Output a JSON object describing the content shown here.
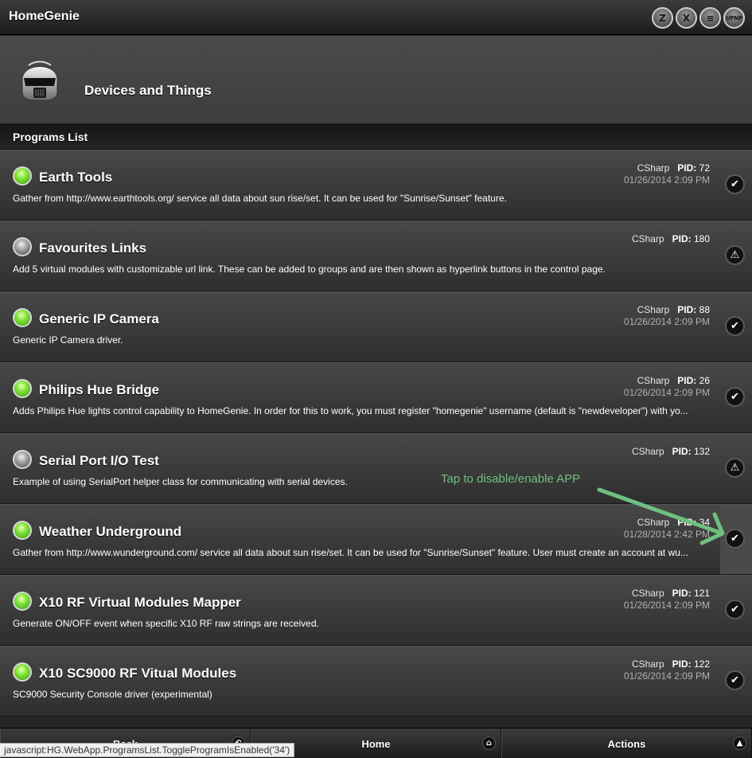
{
  "app": {
    "title": "HomeGenie",
    "interfaces": [
      {
        "icon": "zwave-icon",
        "glyph": "Z"
      },
      {
        "icon": "x10-icon",
        "glyph": "X"
      },
      {
        "icon": "insteon-icon",
        "glyph": "≡"
      },
      {
        "icon": "upnp-icon",
        "glyph": "UPNP"
      }
    ]
  },
  "page": {
    "title": "Devices and Things"
  },
  "list": {
    "header": "Programs List",
    "pid_label": "PID:",
    "programs": [
      {
        "name": "Earth Tools",
        "description": "Gather from http://www.earthtools.org/ service all data about sun rise/set. It can be used for \"Sunrise/Sunset\" feature.",
        "lang": "CSharp",
        "pid": "72",
        "date": "01/26/2014 2:09 PM",
        "enabled": true,
        "toggle_glyph": "✔"
      },
      {
        "name": "Favourites Links",
        "description": "Add 5 virtual modules with customizable url link. These can be added to groups and are then shown as hyperlink buttons in the control page.",
        "lang": "CSharp",
        "pid": "180",
        "date": "",
        "enabled": false,
        "toggle_glyph": "⚠"
      },
      {
        "name": "Generic IP Camera",
        "description": "Generic IP Camera driver.",
        "lang": "CSharp",
        "pid": "88",
        "date": "01/26/2014 2:09 PM",
        "enabled": true,
        "toggle_glyph": "✔"
      },
      {
        "name": "Philips Hue Bridge",
        "description": "Adds Philips Hue lights control capability to HomeGenie. In order for this to work, you must register \"homegenie\" username (default is \"newdeveloper\") with yo...",
        "lang": "CSharp",
        "pid": "26",
        "date": "01/26/2014 2:09 PM",
        "enabled": true,
        "toggle_glyph": "✔"
      },
      {
        "name": "Serial Port I/O Test",
        "description": "Example of using SerialPort helper class for communicating with serial devices.",
        "lang": "CSharp",
        "pid": "132",
        "date": "",
        "enabled": false,
        "toggle_glyph": "⚠"
      },
      {
        "name": "Weather Underground",
        "description": "Gather from http://www.wunderground.com/ service all data about sun rise/set. It can be used for \"Sunrise/Sunset\" feature. User must create an account at wu...",
        "lang": "CSharp",
        "pid": "34",
        "date": "01/28/2014 2:42 PM",
        "enabled": true,
        "toggle_glyph": "✔"
      },
      {
        "name": "X10 RF Virtual Modules Mapper",
        "description": "Generate ON/OFF event when specific X10 RF raw strings are received.",
        "lang": "CSharp",
        "pid": "121",
        "date": "01/26/2014 2:09 PM",
        "enabled": true,
        "toggle_glyph": "✔"
      },
      {
        "name": "X10 SC9000 RF Vitual Modules",
        "description": "SC9000 Security Console driver (experimental)",
        "lang": "CSharp",
        "pid": "122",
        "date": "01/26/2014 2:09 PM",
        "enabled": true,
        "toggle_glyph": "✔"
      }
    ]
  },
  "annotation": {
    "text": "Tap to disable/enable APP",
    "color": "#6fc07f"
  },
  "footer": {
    "back_label": "Back",
    "home_label": "Home",
    "actions_label": "Actions",
    "back_glyph": "↶",
    "home_glyph": "⌂",
    "actions_glyph": "▲"
  },
  "statusbar": {
    "text": "javascript:HG.WebApp.ProgramsList.ToggleProgramIsEnabled('34')"
  }
}
